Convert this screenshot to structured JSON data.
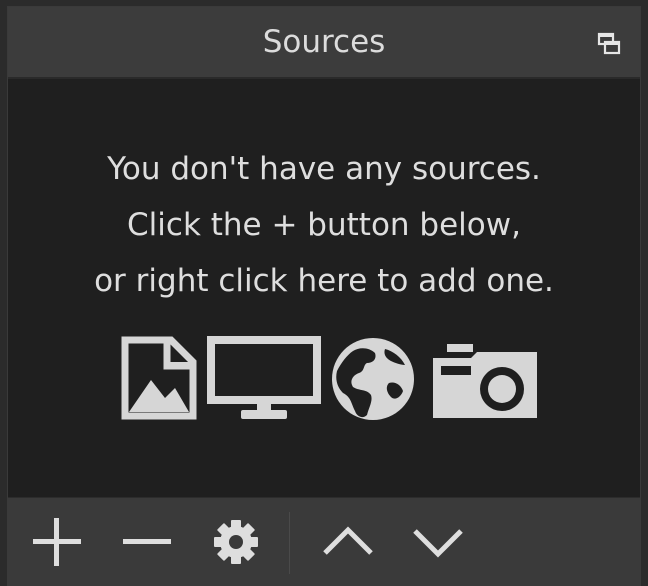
{
  "dock": {
    "title": "Sources",
    "float_button_icon": "float-window-icon"
  },
  "empty_state": {
    "line1": "You don't have any sources.",
    "line2": "Click the + button below,",
    "line3": "or right click here to add one.",
    "icons": [
      "image-icon",
      "monitor-icon",
      "globe-icon",
      "camera-icon"
    ]
  },
  "toolbar": {
    "buttons": [
      {
        "name": "add-source-button",
        "icon": "plus-icon"
      },
      {
        "name": "remove-source-button",
        "icon": "minus-icon"
      },
      {
        "name": "source-properties-button",
        "icon": "gear-icon"
      },
      {
        "name": "move-source-up-button",
        "icon": "chevron-up-icon"
      },
      {
        "name": "move-source-down-button",
        "icon": "chevron-down-icon"
      }
    ]
  },
  "colors": {
    "panel_background": "#1f1f1f",
    "titlebar_background": "#3c3c3c",
    "toolbar_background": "#3a3a3a",
    "text": "#dedede",
    "icon": "#d6d6d6"
  }
}
